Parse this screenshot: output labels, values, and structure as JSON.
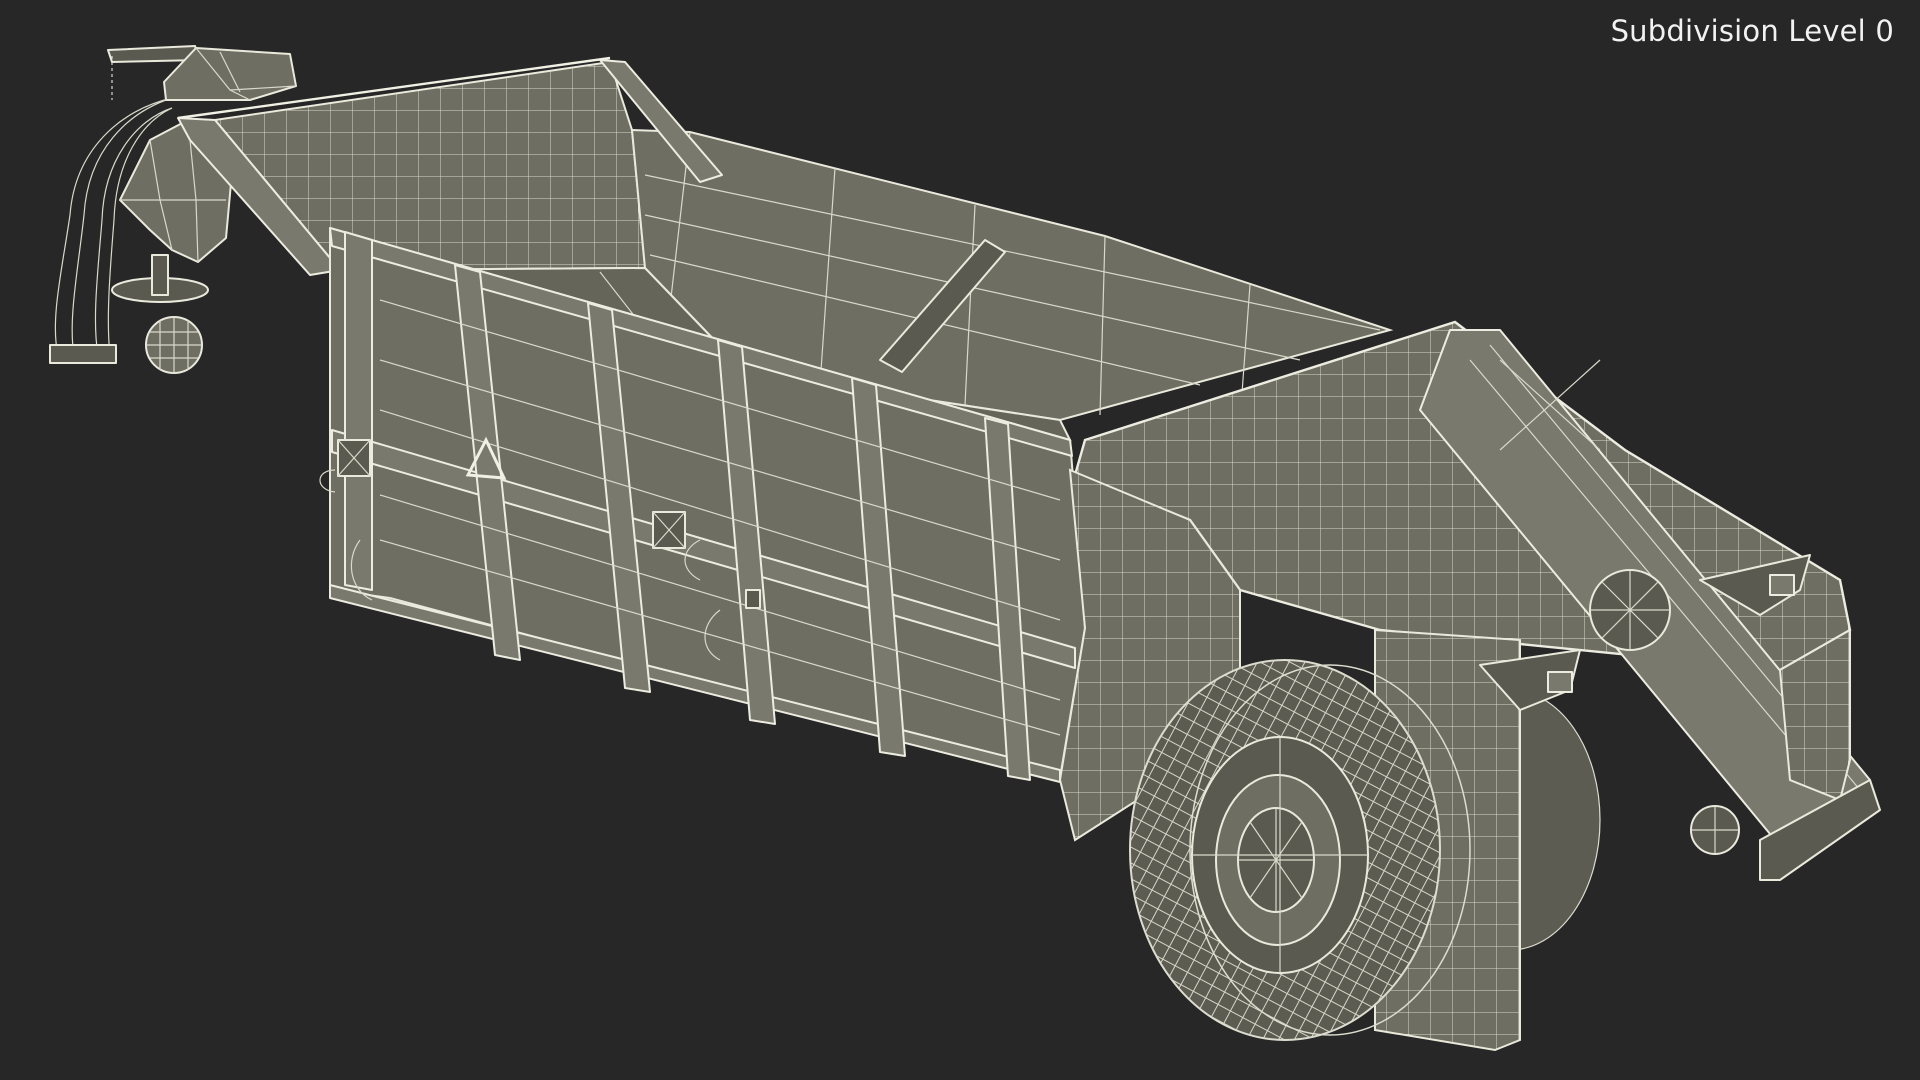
{
  "viewport": {
    "background": "#272727",
    "model_fill": "#6f6e62",
    "wire_color": "#e9e9dc",
    "overlay": {
      "label": "Subdivision Level 0",
      "text_color": "#f2f2f2"
    }
  }
}
